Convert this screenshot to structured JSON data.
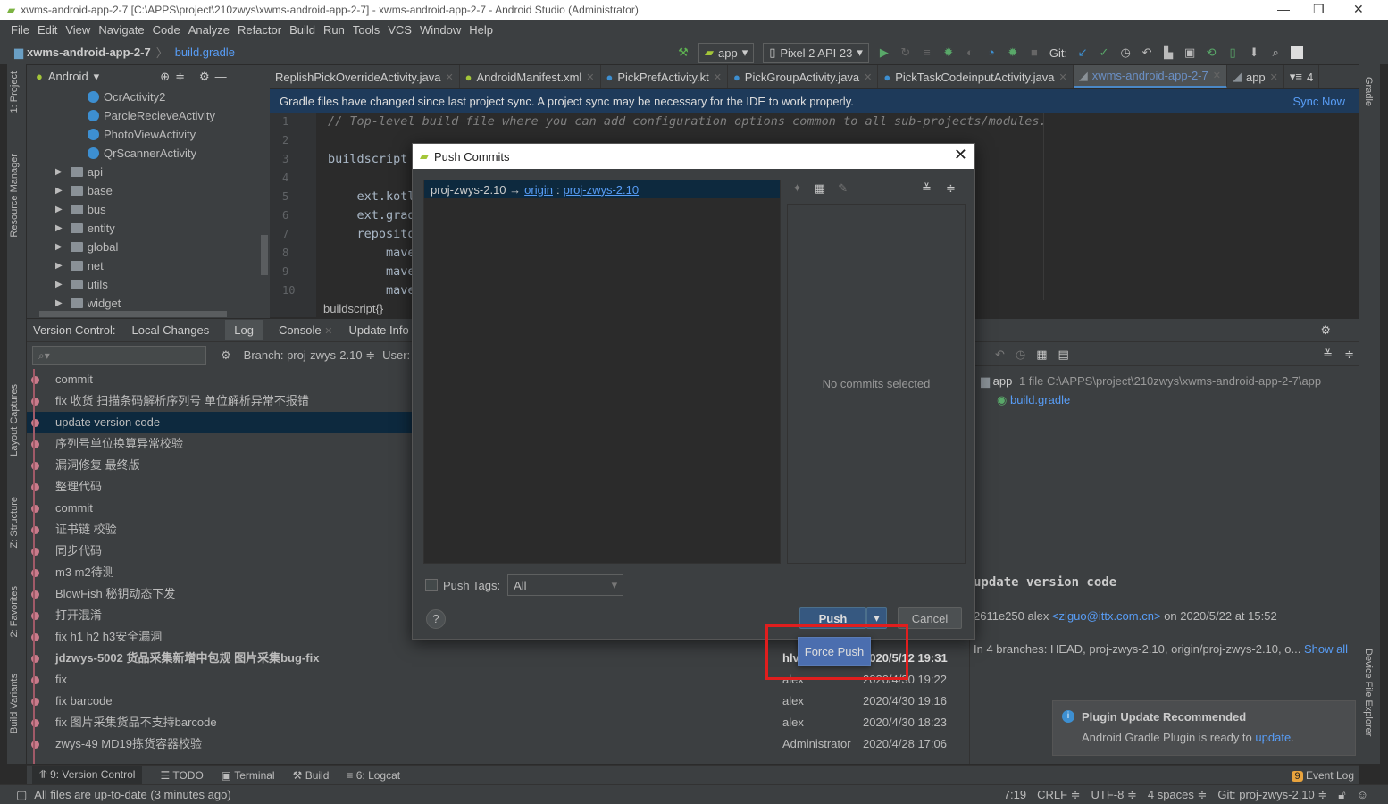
{
  "window": {
    "title": "xwms-android-app-2-7 [C:\\APPS\\project\\210zwys\\xwms-android-app-2-7] - xwms-android-app-2-7 - Android Studio (Administrator)"
  },
  "menu": [
    "File",
    "Edit",
    "View",
    "Navigate",
    "Code",
    "Analyze",
    "Refactor",
    "Build",
    "Run",
    "Tools",
    "VCS",
    "Window",
    "Help"
  ],
  "nav": {
    "project": "xwms-android-app-2-7",
    "file": "build.gradle"
  },
  "toolbar": {
    "run_config": "app",
    "device": "Pixel 2 API 23",
    "git_label": "Git:"
  },
  "left_strip": [
    "1: Project",
    "Resource Manager",
    "Layout Captures",
    "Z: Structure",
    "2: Favorites",
    "Build Variants"
  ],
  "right_strip": [
    "Gradle",
    "Device File Explorer"
  ],
  "project": {
    "view": "Android",
    "items": [
      {
        "label": "OcrActivity2",
        "type": "class"
      },
      {
        "label": "ParcleRecieveActivity",
        "type": "class"
      },
      {
        "label": "PhotoViewActivity",
        "type": "class"
      },
      {
        "label": "QrScannerActivity",
        "type": "class"
      },
      {
        "label": "api",
        "type": "folder"
      },
      {
        "label": "base",
        "type": "folder"
      },
      {
        "label": "bus",
        "type": "folder"
      },
      {
        "label": "entity",
        "type": "folder"
      },
      {
        "label": "global",
        "type": "folder"
      },
      {
        "label": "net",
        "type": "folder"
      },
      {
        "label": "utils",
        "type": "folder"
      },
      {
        "label": "widget",
        "type": "folder"
      }
    ]
  },
  "tabs": [
    "ReplishPickOverrideActivity.java",
    "AndroidManifest.xml",
    "PickPrefActivity.kt",
    "PickGroupActivity.java",
    "PickTaskCodeinputActivity.java",
    "xwms-android-app-2-7",
    "app"
  ],
  "tabs_overflow": "4",
  "banner": {
    "text": "Gradle files have changed since last project sync. A project sync may be necessary for the IDE to work properly.",
    "action": "Sync Now"
  },
  "editor": {
    "lines": [
      "1",
      "2",
      "3",
      "4",
      "5",
      "6",
      "7",
      "8",
      "9",
      "10"
    ],
    "code": [
      "// Top-level build file where you can add configuration options common to all sub-projects/modules.",
      "",
      "buildscript",
      "",
      "    ext.kotl",
      "    ext.grad",
      "    reposito",
      "        mave",
      "        mave",
      "        mave"
    ],
    "breadcrumb": "buildscript{}"
  },
  "vc": {
    "label": "Version Control:",
    "tabs": [
      "Local Changes",
      "Log",
      "Console",
      "Update Info"
    ],
    "branch": "Branch: proj-zwys-2.10 ≑",
    "user": "User: ..",
    "log": [
      {
        "msg": "commit"
      },
      {
        "msg": "fix 收货 扫描条码解析序列号 单位解析异常不报错"
      },
      {
        "msg": "update version code",
        "selected": true
      },
      {
        "msg": "序列号单位换算异常校验"
      },
      {
        "msg": "漏洞修复 最终版"
      },
      {
        "msg": "整理代码"
      },
      {
        "msg": "commit"
      },
      {
        "msg": "证书链 校验"
      },
      {
        "msg": "同步代码"
      },
      {
        "msg": "m3 m2待测"
      },
      {
        "msg": "BlowFish 秘钥动态下发"
      },
      {
        "msg": "打开混淆"
      },
      {
        "msg": "fix h1 h2 h3安全漏洞"
      },
      {
        "msg": "jdzwys-5002  货品采集新增中包规 图片采集bug-fix",
        "author": "hlv",
        "date": "2020/5/12 19:31",
        "bold": true
      },
      {
        "msg": "fix",
        "author": "alex",
        "date": "2020/4/30 19:22"
      },
      {
        "msg": "fix barcode",
        "author": "alex",
        "date": "2020/4/30 19:16"
      },
      {
        "msg": "fix 图片采集货品不支持barcode",
        "author": "alex",
        "date": "2020/4/30 18:23"
      },
      {
        "msg": "zwys-49 MD19拣货容器校验",
        "author": "Administrator",
        "date": "2020/4/28 17:06"
      }
    ],
    "changes": {
      "module": "app",
      "count": "1 file",
      "path": "C:\\APPS\\project\\210zwys\\xwms-android-app-2-7\\app",
      "file": "build.gradle"
    },
    "detail": {
      "subject": "update version code",
      "hash": "2611e250 alex",
      "email": "<zlguo@ittx.com.cn>",
      "when": "on 2020/5/22 at 15:52",
      "branches": "In 4 branches: HEAD, proj-zwys-2.10, origin/proj-zwys-2.10, o...",
      "show_all": "Show all"
    }
  },
  "dialog": {
    "title": "Push Commits",
    "source": "proj-zwys-2.10 →",
    "remote": "origin",
    "sep": ":",
    "target": "proj-zwys-2.10",
    "no_commits": "No commits selected",
    "push_tags_label": "Push Tags:",
    "push_tags_value": "All",
    "push_tags_checked": false,
    "push": "Push",
    "cancel": "Cancel",
    "help": "?",
    "force_push": "Force Push"
  },
  "notification": {
    "title": "Plugin Update Recommended",
    "body": "Android Gradle Plugin is ready to",
    "link": "update",
    "end": "."
  },
  "bottom_tabs": [
    "9: Version Control",
    "TODO",
    "Terminal",
    "Build",
    "6: Logcat"
  ],
  "event_log": {
    "label": "Event Log",
    "count": "9"
  },
  "status": {
    "message": "All files are up-to-date (3 minutes ago)",
    "position": "7:19",
    "line_sep": "CRLF ≑",
    "encoding": "UTF-8 ≑",
    "indent": "4 spaces ≑",
    "git": "Git: proj-zwys-2.10 ≑"
  },
  "colors": {
    "accent": "#4b6eaf",
    "link": "#589df6",
    "highlight_box": "#e01e1e",
    "selection": "#0d293e"
  }
}
